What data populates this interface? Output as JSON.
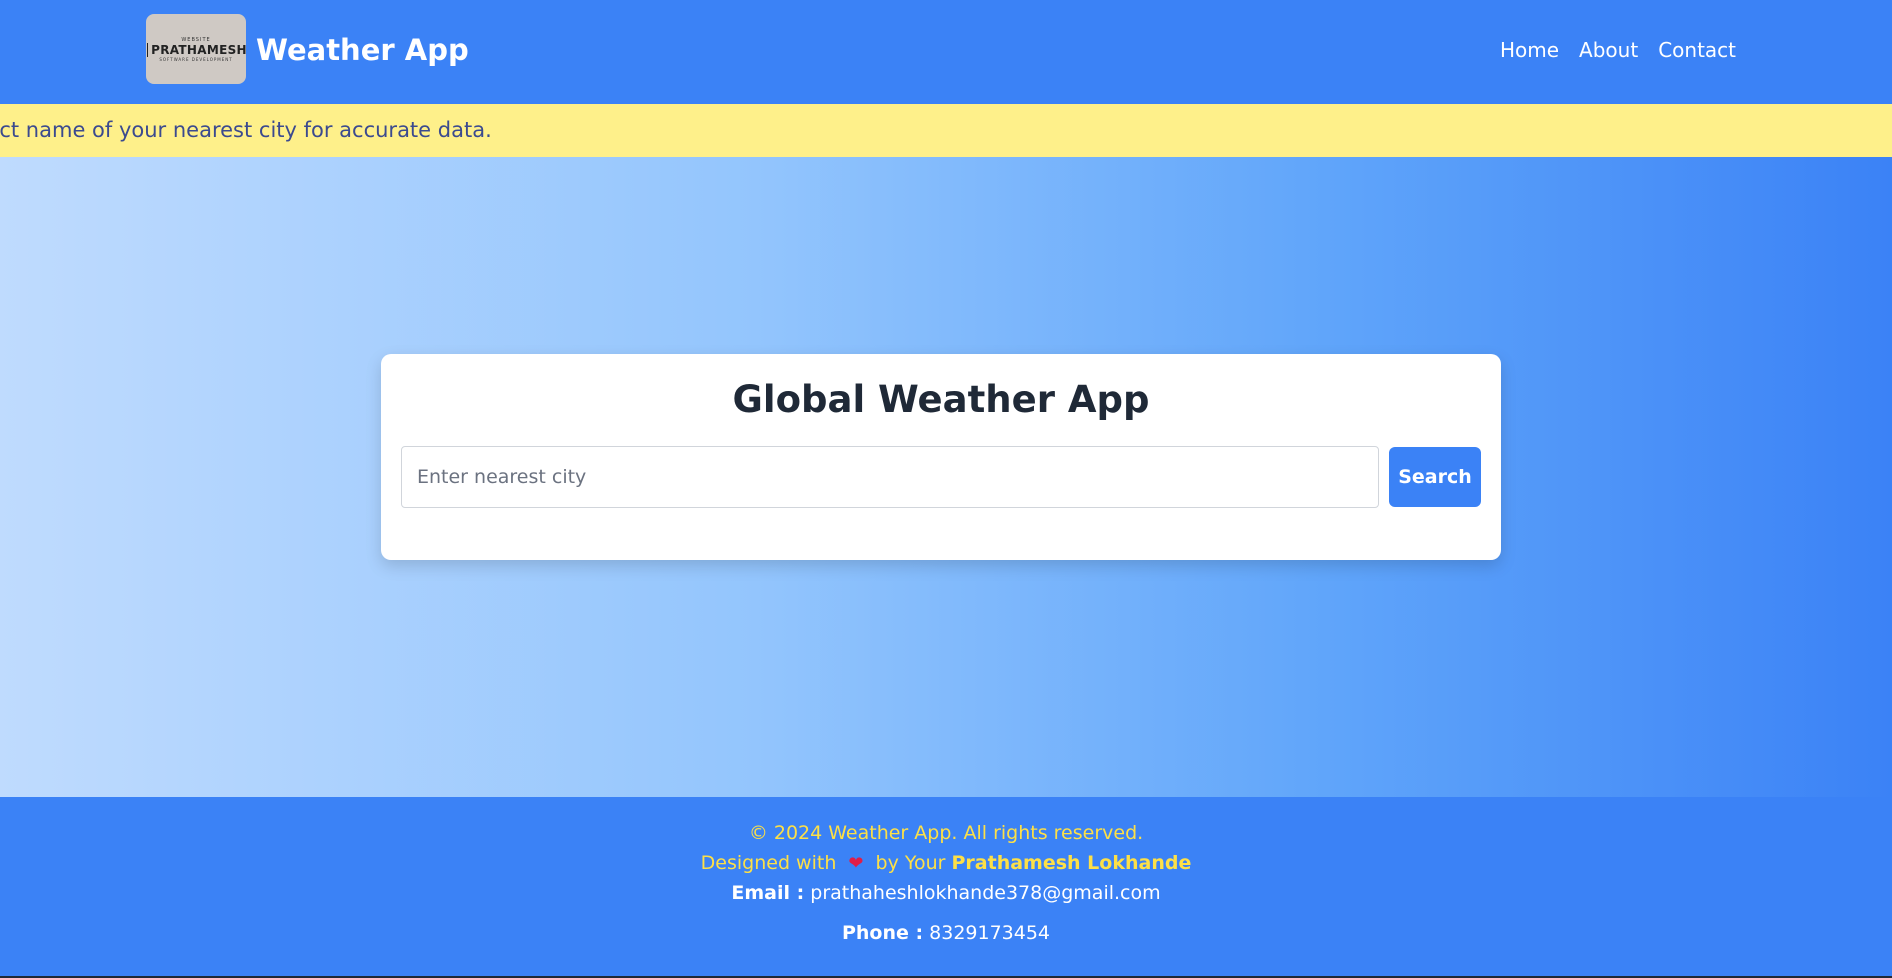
{
  "header": {
    "logo": {
      "top_text": "WEBSITE",
      "main_text": "PRATHAMESH",
      "sub_text": "SOFTWARE DEVELOPMENT"
    },
    "brand": "Weather App",
    "nav": [
      "Home",
      "About",
      "Contact"
    ]
  },
  "notice": {
    "text": "rrect name of your nearest city for accurate data."
  },
  "card": {
    "title": "Global Weather App",
    "search_placeholder": "Enter nearest city",
    "search_value": "",
    "search_button": "Search"
  },
  "footer": {
    "copyright": "© 2024 Weather App. All rights reserved.",
    "designed_prefix": "Designed with",
    "heart_symbol": "❤",
    "designed_middle": "by Your",
    "author": "Prathamesh Lokhande",
    "email_label": "Email :",
    "email": "prathaheshlokhande378@gmail.com",
    "phone_label": "Phone :",
    "phone": "8329173454"
  },
  "colors": {
    "primary": "#3b82f6",
    "notice_bg": "#fef08a",
    "footer_accent": "#fde047",
    "heart": "#e11d48"
  },
  "icons": [
    "logo-image",
    "heart-icon"
  ]
}
